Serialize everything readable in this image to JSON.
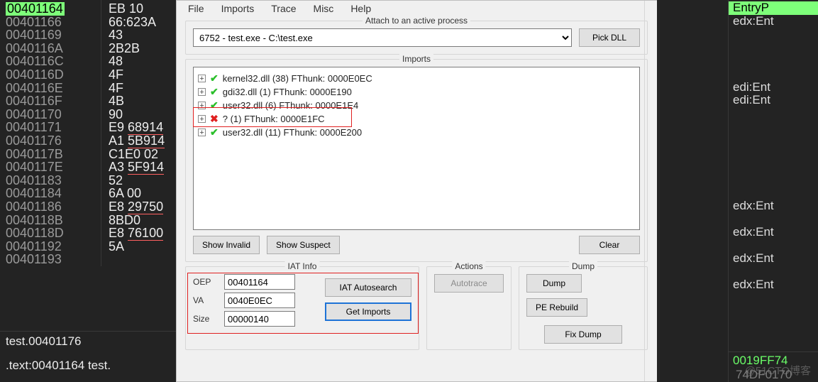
{
  "bg": {
    "addresses": [
      "00401164",
      "00401166",
      "00401169",
      "0040116A",
      "0040116C",
      "0040116D",
      "0040116E",
      "0040116F",
      "00401170",
      "00401171",
      "00401176",
      "0040117B",
      "0040117E",
      "00401183",
      "00401184",
      "00401186",
      "0040118B",
      "0040118D",
      "00401192",
      "00401193"
    ],
    "bytes": [
      "EB 10",
      "66:623A",
      "43",
      "2B2B",
      "48",
      "4F",
      "4F",
      "4B",
      "90",
      "E9 68914",
      "A1 5B914",
      "C1E0 02",
      "A3 5F914",
      "52",
      "6A 00",
      "E8 29750",
      "8BD0",
      "E8 76100",
      "5A",
      ""
    ],
    "bottom1": "test.00401176",
    "bottom2": ".text:00401164 test.",
    "right": [
      "EntryP",
      "edx:Ent",
      "",
      "",
      "",
      "",
      "edi:Ent",
      "edi:Ent",
      "",
      "",
      "",
      "",
      "",
      "",
      "",
      "edx:Ent",
      "",
      "edx:Ent",
      "",
      "edx:Ent",
      "",
      "edx:Ent"
    ],
    "statusgreen": "0019FF74",
    "statusrest": "74DF0170",
    "watermark": "@51CTO博客"
  },
  "menu": {
    "file": "File",
    "imports": "Imports",
    "trace": "Trace",
    "misc": "Misc",
    "help": "Help"
  },
  "attach": {
    "legend": "Attach to an active process",
    "process": "6752 - test.exe - C:\\test.exe",
    "pickdll": "Pick DLL"
  },
  "imports": {
    "legend": "Imports",
    "nodes": [
      {
        "ok": true,
        "text": "kernel32.dll (38) FThunk: 0000E0EC"
      },
      {
        "ok": true,
        "text": "gdi32.dll (1) FThunk: 0000E190"
      },
      {
        "ok": true,
        "text": "user32.dll (6) FThunk: 0000E1E4"
      },
      {
        "ok": false,
        "text": "? (1) FThunk: 0000E1FC"
      },
      {
        "ok": true,
        "text": "user32.dll (11) FThunk: 0000E200"
      }
    ],
    "show_invalid": "Show Invalid",
    "show_suspect": "Show Suspect",
    "clear": "Clear"
  },
  "iat": {
    "legend": "IAT Info",
    "oep_lbl": "OEP",
    "oep": "00401164",
    "va_lbl": "VA",
    "va": "0040E0EC",
    "size_lbl": "Size",
    "size": "00000140",
    "autosearch": "IAT Autosearch",
    "getimports": "Get Imports"
  },
  "actions": {
    "legend": "Actions",
    "autotrace": "Autotrace"
  },
  "dump": {
    "legend": "Dump",
    "dump": "Dump",
    "perebuild": "PE Rebuild",
    "fixdump": "Fix Dump"
  }
}
